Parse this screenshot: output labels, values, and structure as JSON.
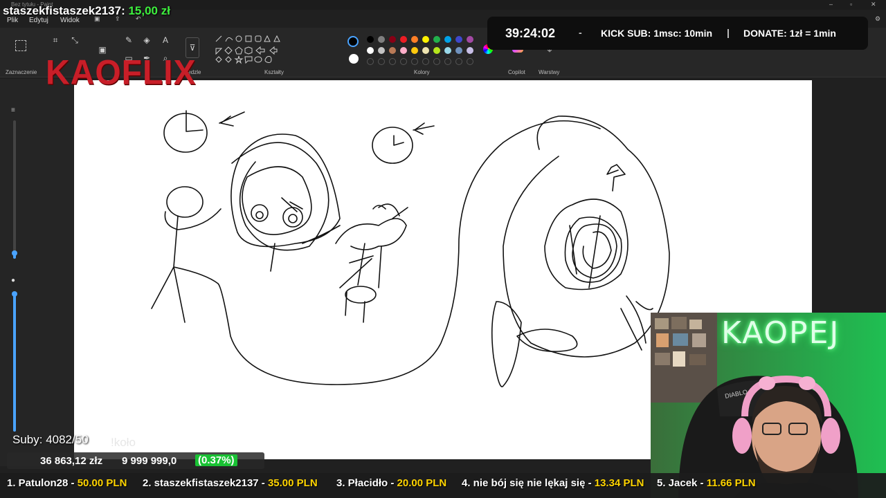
{
  "window": {
    "title": "Bez tytułu - Paint"
  },
  "menu": {
    "file": "Plik",
    "edit": "Edytuj",
    "view": "Widok"
  },
  "ribbon": {
    "groups": {
      "selection": "Zaznaczenie",
      "brushes": "Pędzle",
      "shapes": "Kształty",
      "colors": "Kolory",
      "copilot": "Copilot",
      "layers": "Warstwy"
    },
    "palette_top": [
      "#000000",
      "#7f7f7f",
      "#880015",
      "#ed1c24",
      "#ff7f27",
      "#fff200",
      "#22b14c",
      "#00a2e8",
      "#3f48cc",
      "#a349a4"
    ],
    "palette_bottom": [
      "#ffffff",
      "#c3c3c3",
      "#b97a57",
      "#ffaec9",
      "#ffc90e",
      "#efe4b0",
      "#b5e61d",
      "#99d9ea",
      "#7092be",
      "#c8bfe7"
    ]
  },
  "overlay": {
    "user_name": "staszekfistaszek2137:",
    "user_amount": "15,00 zł",
    "logo": "KAOFLIX",
    "timer": "39:24:02",
    "timer_sep": "-",
    "kick_sub": "KICK SUB: 1msc: 10min",
    "sep": "|",
    "donate": "DONATE: 1zł = 1min",
    "subs": "Suby: 4082/50",
    "kolo": "!koło",
    "money_current": "36 863,12 złz",
    "money_goal": "9 999 999,0",
    "money_pct": "(0.37%)",
    "webcam_sign": "KAOPEJ"
  },
  "ticker": [
    {
      "name": "1. Patulon28 - ",
      "amount": "50.00 PLN"
    },
    {
      "name": "2. staszekfistaszek2137 - ",
      "amount": "35.00 PLN"
    },
    {
      "name": "3. Płacidło - ",
      "amount": "20.00 PLN"
    },
    {
      "name": "4. nie bój się nie lękaj się - ",
      "amount": "13.34 PLN"
    },
    {
      "name": "5. Jacek - ",
      "amount": "11.66 PLN"
    }
  ]
}
